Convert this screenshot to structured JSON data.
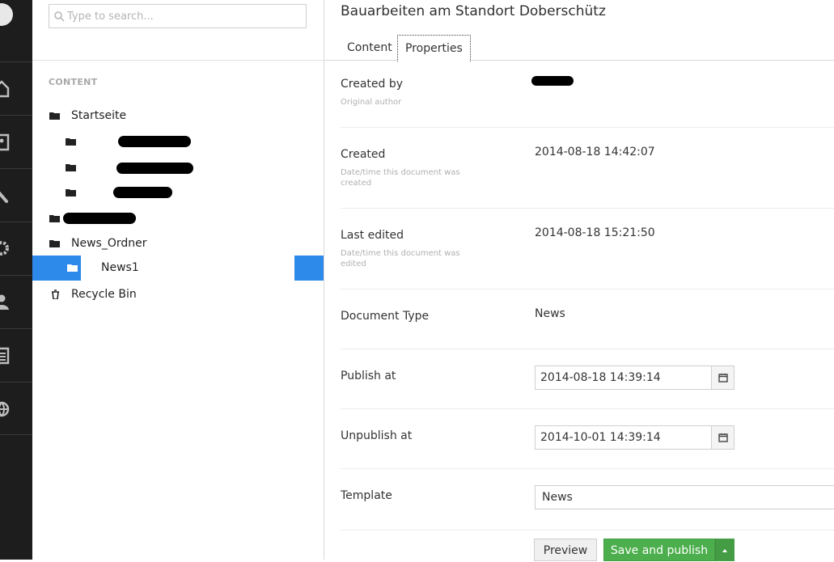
{
  "search": {
    "placeholder": "Type to search..."
  },
  "tree": {
    "heading": "CONTENT",
    "nodes": [
      {
        "label": "Startseite"
      },
      {
        "label": "News_Ordner"
      },
      {
        "label": "News1"
      },
      {
        "label": "Recycle Bin"
      }
    ]
  },
  "document": {
    "title": "Bauarbeiten am Standort Doberschütz",
    "tabs": [
      {
        "label": "Content"
      },
      {
        "label": "Properties"
      }
    ],
    "properties": {
      "created_by": {
        "label": "Created by",
        "desc": "Original author"
      },
      "created": {
        "label": "Created",
        "desc": "Date/time this document was created",
        "value": "2014-08-18 14:42:07"
      },
      "last_edited": {
        "label": "Last edited",
        "desc": "Date/time this document was edited",
        "value": "2014-08-18 15:21:50"
      },
      "doc_type": {
        "label": "Document Type",
        "value": "News"
      },
      "publish_at": {
        "label": "Publish at",
        "value": "2014-08-18 14:39:14"
      },
      "unpublish_at": {
        "label": "Unpublish at",
        "value": "2014-10-01 14:39:14"
      },
      "template": {
        "label": "Template",
        "value": "News"
      }
    }
  },
  "actions": {
    "preview": "Preview",
    "save_publish": "Save and publish"
  },
  "colors": {
    "selection": "#2e8aea",
    "save": "#4cae4c",
    "appbar": "#1d1d1d"
  }
}
